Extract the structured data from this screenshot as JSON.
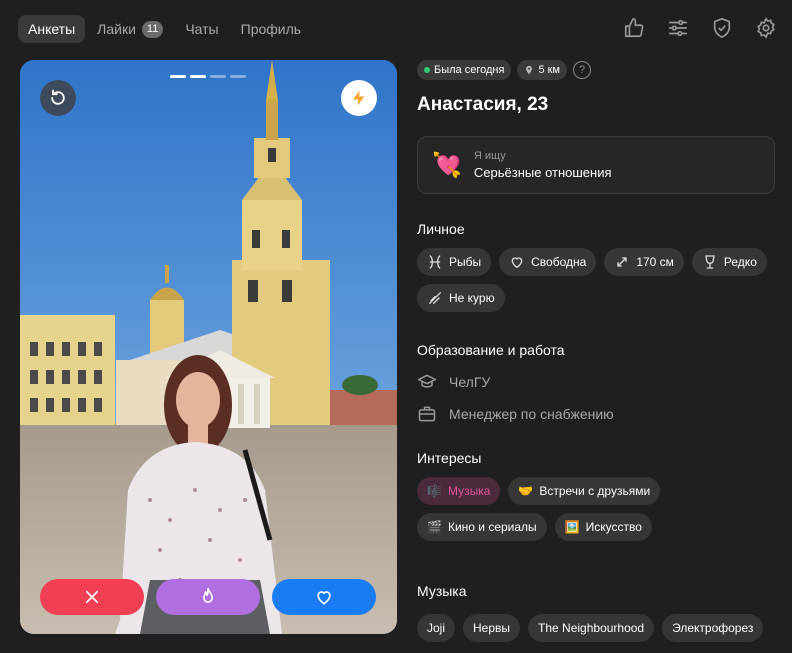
{
  "nav": {
    "tabs": [
      {
        "label": "Анкеты",
        "active": true
      },
      {
        "label": "Лайки",
        "badge": "11"
      },
      {
        "label": "Чаты"
      },
      {
        "label": "Профиль"
      }
    ],
    "icons": [
      "thumbs-up-icon",
      "filters-icon",
      "shield-check-icon",
      "gear-icon"
    ]
  },
  "photo": {
    "slides_total": 4,
    "current_slide": 2
  },
  "profile": {
    "status": "Была сегодня",
    "distance": "5 км",
    "help": "?",
    "name": "Анастасия, 23",
    "looking_for_label": "Я ищу",
    "looking_for_value": "Серьёзные отношения"
  },
  "personal": {
    "title": "Личное",
    "chips": [
      {
        "icon": "pisces-icon",
        "label": "Рыбы"
      },
      {
        "icon": "heart-outline-icon",
        "label": "Свободна"
      },
      {
        "icon": "height-icon",
        "label": "170 см"
      },
      {
        "icon": "wine-glass-icon",
        "label": "Редко"
      },
      {
        "icon": "no-smoking-icon",
        "label": "Не курю"
      }
    ]
  },
  "education": {
    "title": "Образование и работа",
    "school": "ЧелГУ",
    "job": "Менеджер по снабжению"
  },
  "interests": {
    "title": "Интересы",
    "chips": [
      {
        "emoji": "🎼",
        "label": "Музыка",
        "highlight": true
      },
      {
        "emoji": "🤝",
        "label": "Встречи с друзьями"
      },
      {
        "emoji": "🎬",
        "label": "Кино и сериалы"
      },
      {
        "emoji": "🖼️",
        "label": "Искусство"
      }
    ]
  },
  "music": {
    "title": "Музыка",
    "chips": [
      "Joji",
      "Нервы",
      "The Neighbourhood",
      "Электрофорез"
    ]
  },
  "colors": {
    "background": "#1f1f1f",
    "dislike": "#f23f54",
    "superlike": "#b06ee0",
    "like": "#1a7cf2",
    "online": "#2ecc71",
    "highlight": "#e0569a"
  }
}
